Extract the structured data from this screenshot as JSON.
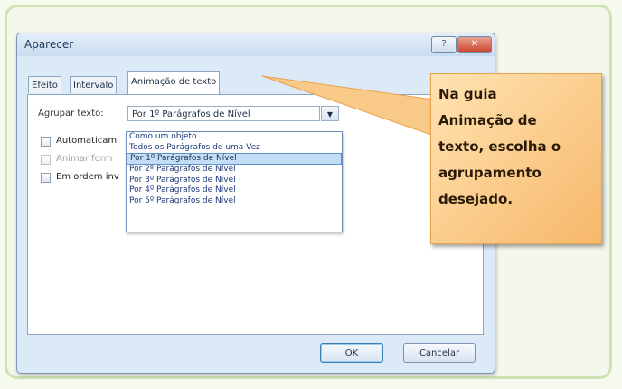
{
  "dialog": {
    "title": "Aparecer",
    "help_label": "?",
    "close_label": "✕",
    "tabs": [
      {
        "label": "Efeito"
      },
      {
        "label": "Intervalo"
      },
      {
        "label": "Animação de texto"
      }
    ],
    "grouping_label": "Agrupar texto:",
    "grouping_value": "Por 1º Parágrafos de Nível",
    "dropdown_arrow": "▼",
    "options": [
      "Como um objeto",
      "Todos os Parágrafos de uma Vez",
      "Por 1º Parágrafos de Nível",
      "Por 2º Parágrafos de Nível",
      "Por 3º Parágrafos de Nível",
      "Por 4º Parágrafos de Nível",
      "Por 5º Parágrafos de Nível"
    ],
    "selected_option_index": 2,
    "checkboxes": [
      {
        "label": "Automaticam"
      },
      {
        "label": "Animar form"
      },
      {
        "label": "Em ordem inv"
      }
    ],
    "ok_label": "OK",
    "cancel_label": "Cancelar"
  },
  "callout": {
    "text_lines": [
      "Na guia",
      "Animação de",
      "texto, escolha o",
      "agrupamento",
      "desejado."
    ]
  }
}
